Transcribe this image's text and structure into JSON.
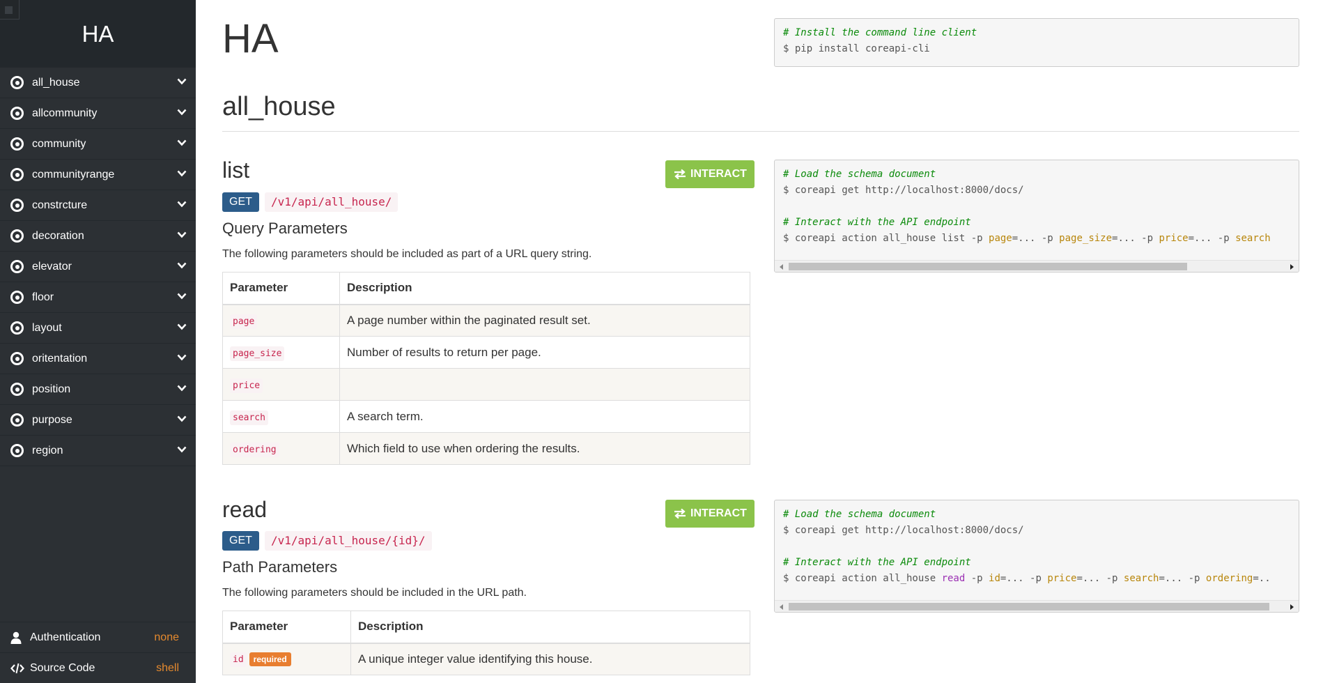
{
  "sidebar": {
    "brand": "HA",
    "items": [
      {
        "label": "all_house"
      },
      {
        "label": "allcommunity"
      },
      {
        "label": "community"
      },
      {
        "label": "communityrange"
      },
      {
        "label": "constrcture"
      },
      {
        "label": "decoration"
      },
      {
        "label": "elevator"
      },
      {
        "label": "floor"
      },
      {
        "label": "layout"
      },
      {
        "label": "oritentation"
      },
      {
        "label": "position"
      },
      {
        "label": "purpose"
      },
      {
        "label": "region"
      }
    ],
    "bottom": {
      "auth_label": "Authentication",
      "auth_value": "none",
      "source_label": "Source Code",
      "source_value": "shell"
    }
  },
  "main": {
    "title": "HA",
    "install": {
      "comment": "# Install the command line client",
      "command": "$ pip install coreapi-cli"
    },
    "section_title": "all_house",
    "list": {
      "title": "list",
      "interact_label": "INTERACT",
      "method": "GET",
      "path": "/v1/api/all_house/",
      "params_title": "Query Parameters",
      "params_desc": "The following parameters should be included as part of a URL query string.",
      "headers": {
        "param": "Parameter",
        "desc": "Description"
      },
      "rows": [
        {
          "name": "page",
          "desc": "A page number within the paginated result set."
        },
        {
          "name": "page_size",
          "desc": "Number of results to return per page."
        },
        {
          "name": "price",
          "desc": ""
        },
        {
          "name": "search",
          "desc": "A search term."
        },
        {
          "name": "ordering",
          "desc": "Which field to use when ordering the results."
        }
      ],
      "code": {
        "c1": "# Load the schema document",
        "l1": "$ coreapi get http://localhost:8000/docs/",
        "c2": "# Interact with the API endpoint",
        "l2_prefix": "$ coreapi action all_house list -p ",
        "p1": "page",
        "sep1": "=... -p ",
        "p2": "page_size",
        "sep2": "=... -p ",
        "p3": "price",
        "sep3": "=... -p ",
        "p4": "search"
      }
    },
    "read": {
      "title": "read",
      "interact_label": "INTERACT",
      "method": "GET",
      "path": "/v1/api/all_house/{id}/",
      "params_title": "Path Parameters",
      "params_desc": "The following parameters should be included in the URL path.",
      "headers": {
        "param": "Parameter",
        "desc": "Description"
      },
      "rows": [
        {
          "name": "id",
          "badge": "required",
          "desc": "A unique integer value identifying this house."
        }
      ],
      "code": {
        "c1": "# Load the schema document",
        "l1": "$ coreapi get http://localhost:8000/docs/",
        "c2": "# Interact with the API endpoint",
        "l2_prefix": "$ coreapi action all_house ",
        "action": "read",
        "sep0": " -p ",
        "p1": "id",
        "sep1": "=... -p ",
        "p2": "price",
        "sep2": "=... -p ",
        "p3": "search",
        "sep3": "=... -p ",
        "p4": "ordering",
        "tail": "=.."
      }
    }
  },
  "colors": {
    "sidebar_bg": "#2c3034",
    "brand_bg": "#23282c",
    "interact_green": "#8bc34a",
    "get_blue": "#2c5c8a",
    "code_red": "#c7254e",
    "required_orange": "#e87e30",
    "bottom_value_orange": "#e68a2e"
  }
}
